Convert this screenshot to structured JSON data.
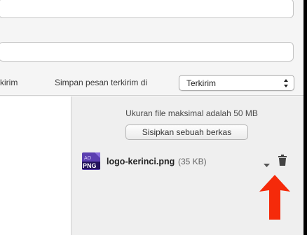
{
  "composer": {
    "option_left_label": "kirim",
    "save_sent_label": "Simpan pesan terkirim di",
    "save_sent_folder": "Terkirim"
  },
  "attachments": {
    "max_size_text": "Ukuran file maksimal adalah 50 MB",
    "attach_button_label": "Sisipkan sebuah berkas",
    "files": [
      {
        "badge_top": "AO",
        "badge_bottom": "PNG",
        "name": "logo-kerinci.png",
        "size": "(35 KB)"
      }
    ]
  },
  "icons": {
    "file_type": "png-file-icon",
    "dropdown": "chevron-down-icon",
    "delete": "trash-icon",
    "annotation": "red-arrow-up-icon",
    "select_arrows": "updown-arrows-icon"
  },
  "colors": {
    "annotation_arrow": "#f52a0a",
    "file_icon": "#5b3fb0"
  }
}
